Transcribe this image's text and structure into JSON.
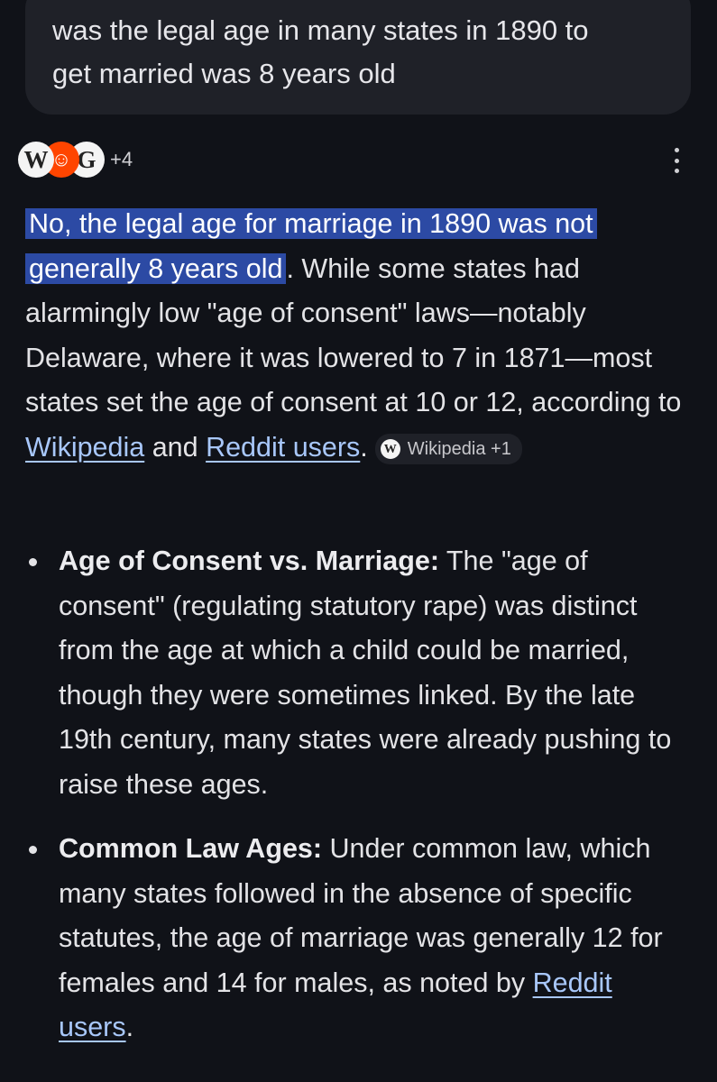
{
  "query": {
    "text": "was the legal age in many states in 1890 to\nget married was 8 years old"
  },
  "sources": {
    "favicons": [
      {
        "icon": "wikipedia-icon",
        "glyph": "W"
      },
      {
        "icon": "reddit-icon",
        "glyph": "☺"
      },
      {
        "icon": "google-icon",
        "glyph": "G"
      }
    ],
    "more_count": "+4"
  },
  "answer": {
    "highlight": "No, the legal age for marriage in 1890 was not generally 8 years old",
    "text_1": ". While some states had alarmingly low \"age of consent\" laws—notably Delaware, where it was lowered to 7 in 1871—most states set the age of consent at 10 or 12, according to ",
    "link_wikipedia": "Wikipedia",
    "text_and": " and ",
    "link_reddit": "Reddit users",
    "text_end": ".",
    "chip": {
      "icon": "wikipedia-icon",
      "label": "Wikipedia +1"
    }
  },
  "bullets": [
    {
      "title": "Age of Consent vs. Marriage:",
      "text": " The \"age of consent\" (regulating statutory rape) was distinct from the age at which a child could be married, though they were sometimes linked. By the late 19th century, many states were already pushing to raise these ages."
    },
    {
      "title": "Common Law Ages:",
      "text": " Under common law, which many states followed in the absence of specific statutes, the age of marriage was generally 12 for females and 14 for males, as noted by ",
      "link": "Reddit users",
      "end": "."
    }
  ],
  "colors": {
    "background": "#101218",
    "bubble": "#1f2128",
    "highlight": "#2c4aa4",
    "link": "#a8c7fa",
    "reddit": "#ff4500"
  }
}
